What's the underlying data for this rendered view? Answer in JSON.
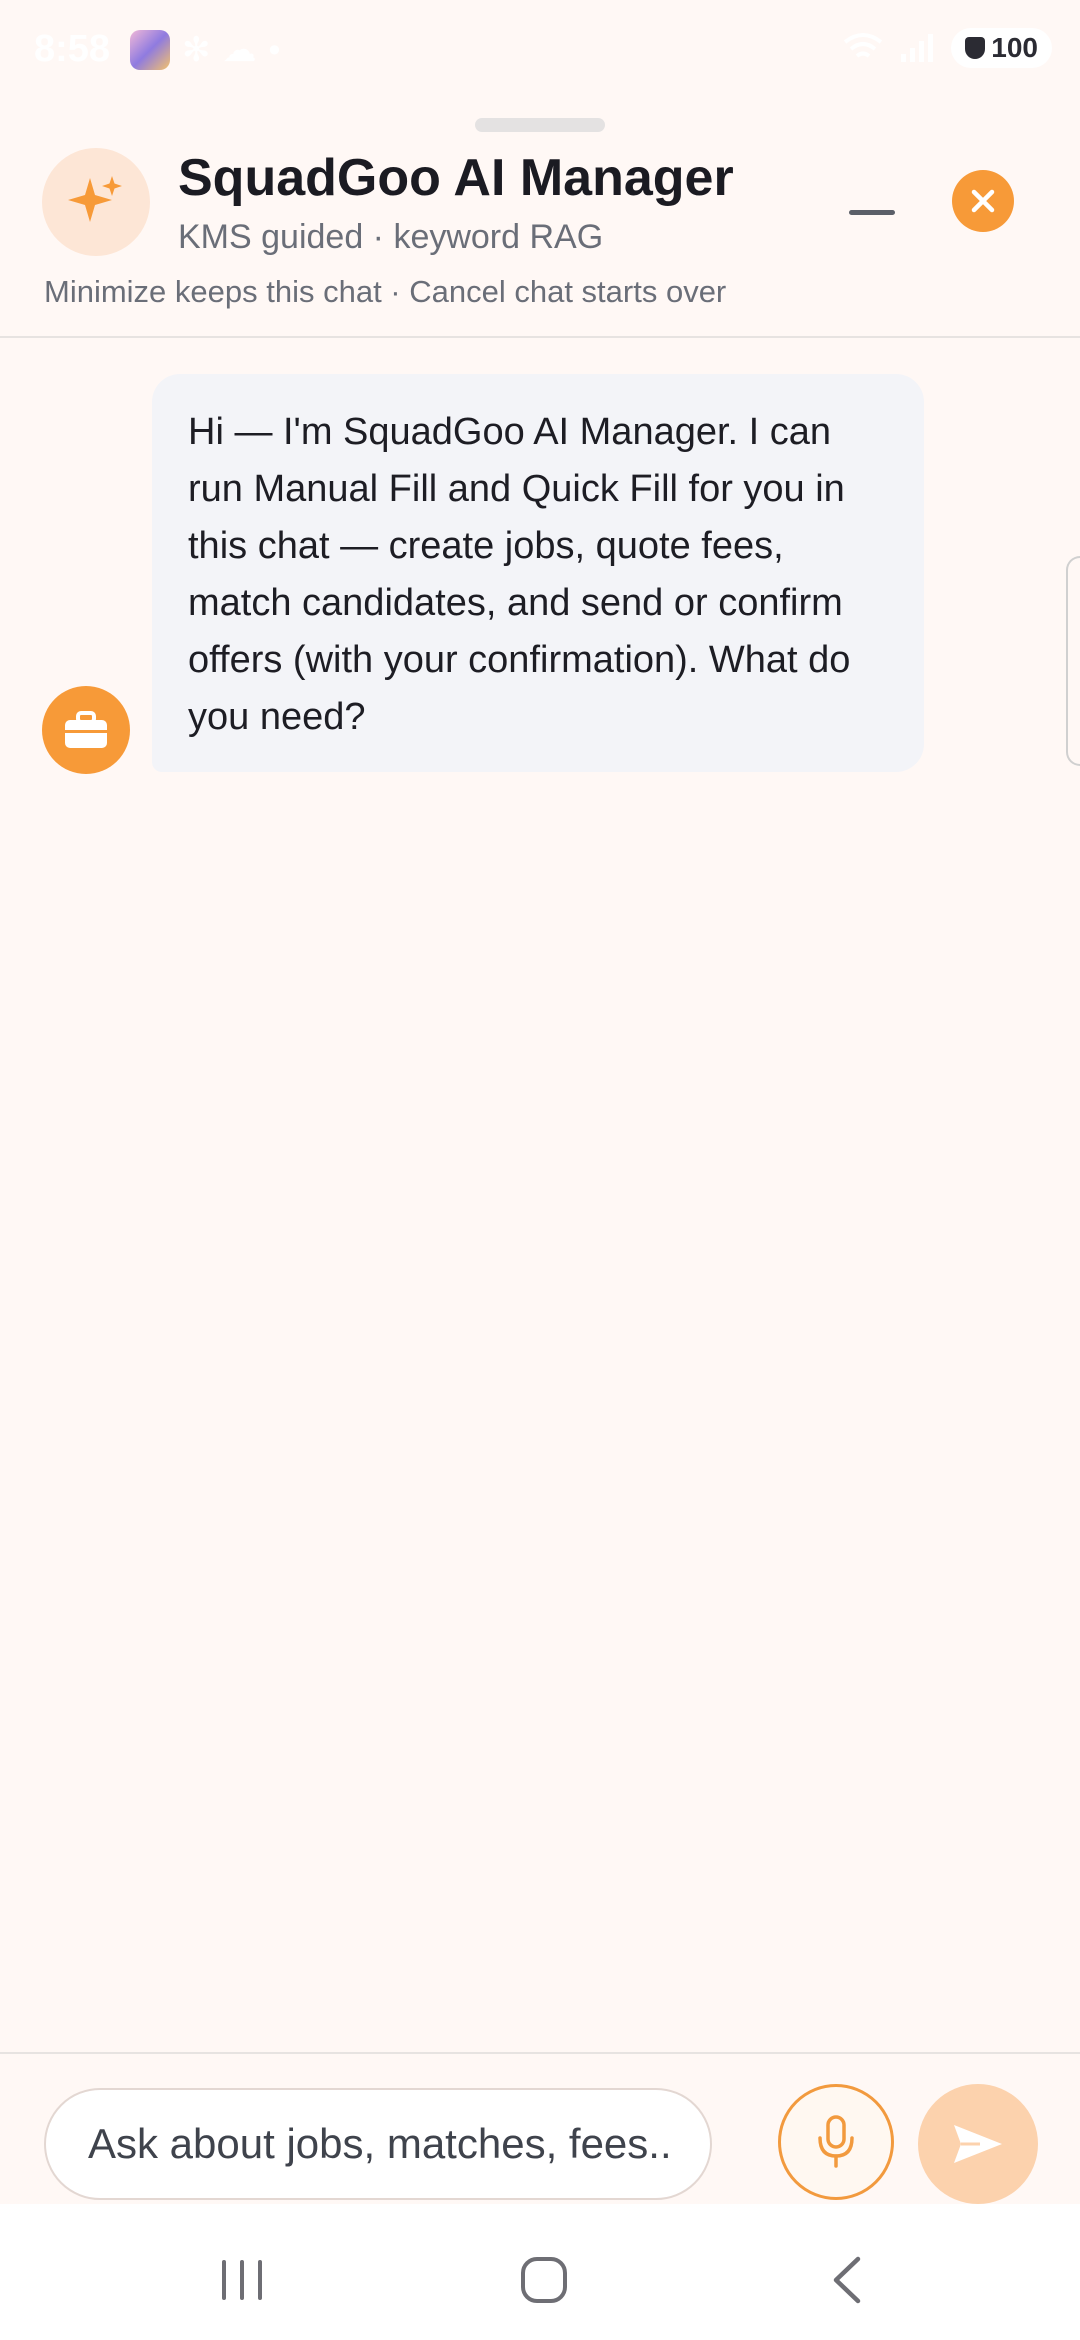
{
  "status_bar": {
    "time": "8:58",
    "battery": "100",
    "icons": [
      "photo-notification-icon",
      "settings-gear-icon",
      "cloud-icon",
      "dot-icon",
      "wifi-icon",
      "signal-icon",
      "shield-icon"
    ]
  },
  "header": {
    "title": "SquadGoo AI Manager",
    "subtitle": "KMS guided · keyword RAG",
    "note": "Minimize keeps this chat · Cancel chat starts over",
    "avatar_icon": "sparkles-icon",
    "minimize_icon": "minimize-icon",
    "close_icon": "close-icon"
  },
  "messages": [
    {
      "sender": "assistant",
      "avatar_icon": "briefcase-icon",
      "text": "Hi — I'm SquadGoo AI Manager. I can run Manual Fill and Quick Fill for you in this chat — create jobs, quote fees, match candidates, and send or confirm offers (with your confirmation). What do you need?"
    }
  ],
  "composer": {
    "placeholder": "Ask about jobs, matches, fees...",
    "value": "",
    "mic_icon": "microphone-icon",
    "send_icon": "send-icon"
  },
  "nav_bar": {
    "icons": [
      "recents-icon",
      "home-icon",
      "back-icon"
    ]
  },
  "colors": {
    "accent": "#f79a38",
    "background": "#fff8f5",
    "bubble": "#f3f4f8",
    "send_disabled": "#fcd2ad"
  }
}
